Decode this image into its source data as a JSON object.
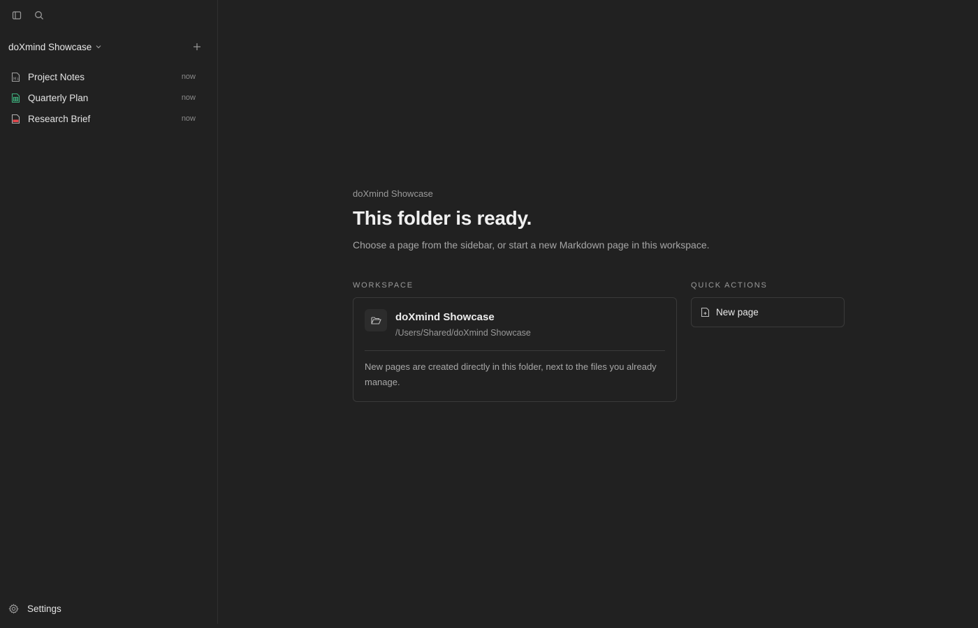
{
  "sidebar": {
    "workspace_name": "doXmind Showcase",
    "items": [
      {
        "label": "Project Notes",
        "time": "now",
        "icon": "markdown-file-icon",
        "color": "#a0a0a0"
      },
      {
        "label": "Quarterly Plan",
        "time": "now",
        "icon": "spreadsheet-file-icon",
        "color": "#3fb27f"
      },
      {
        "label": "Research Brief",
        "time": "now",
        "icon": "pdf-file-icon",
        "color": "#e5484d"
      }
    ],
    "settings_label": "Settings"
  },
  "main": {
    "breadcrumb": "doXmind Showcase",
    "title": "This folder is ready.",
    "subtitle": "Choose a page from the sidebar, or start a new Markdown page in this workspace.",
    "workspace_section_label": "WORKSPACE",
    "workspace_card": {
      "name": "doXmind Showcase",
      "path": "/Users/Shared/doXmind Showcase",
      "note": "New pages are created directly in this folder, next to the files you already manage."
    },
    "quick_actions_label": "QUICK ACTIONS",
    "new_page_label": "New page"
  },
  "colors": {
    "background": "#212121",
    "border": "#3a3a3a",
    "spreadsheet_accent": "#3fb27f",
    "pdf_accent": "#e5484d"
  }
}
